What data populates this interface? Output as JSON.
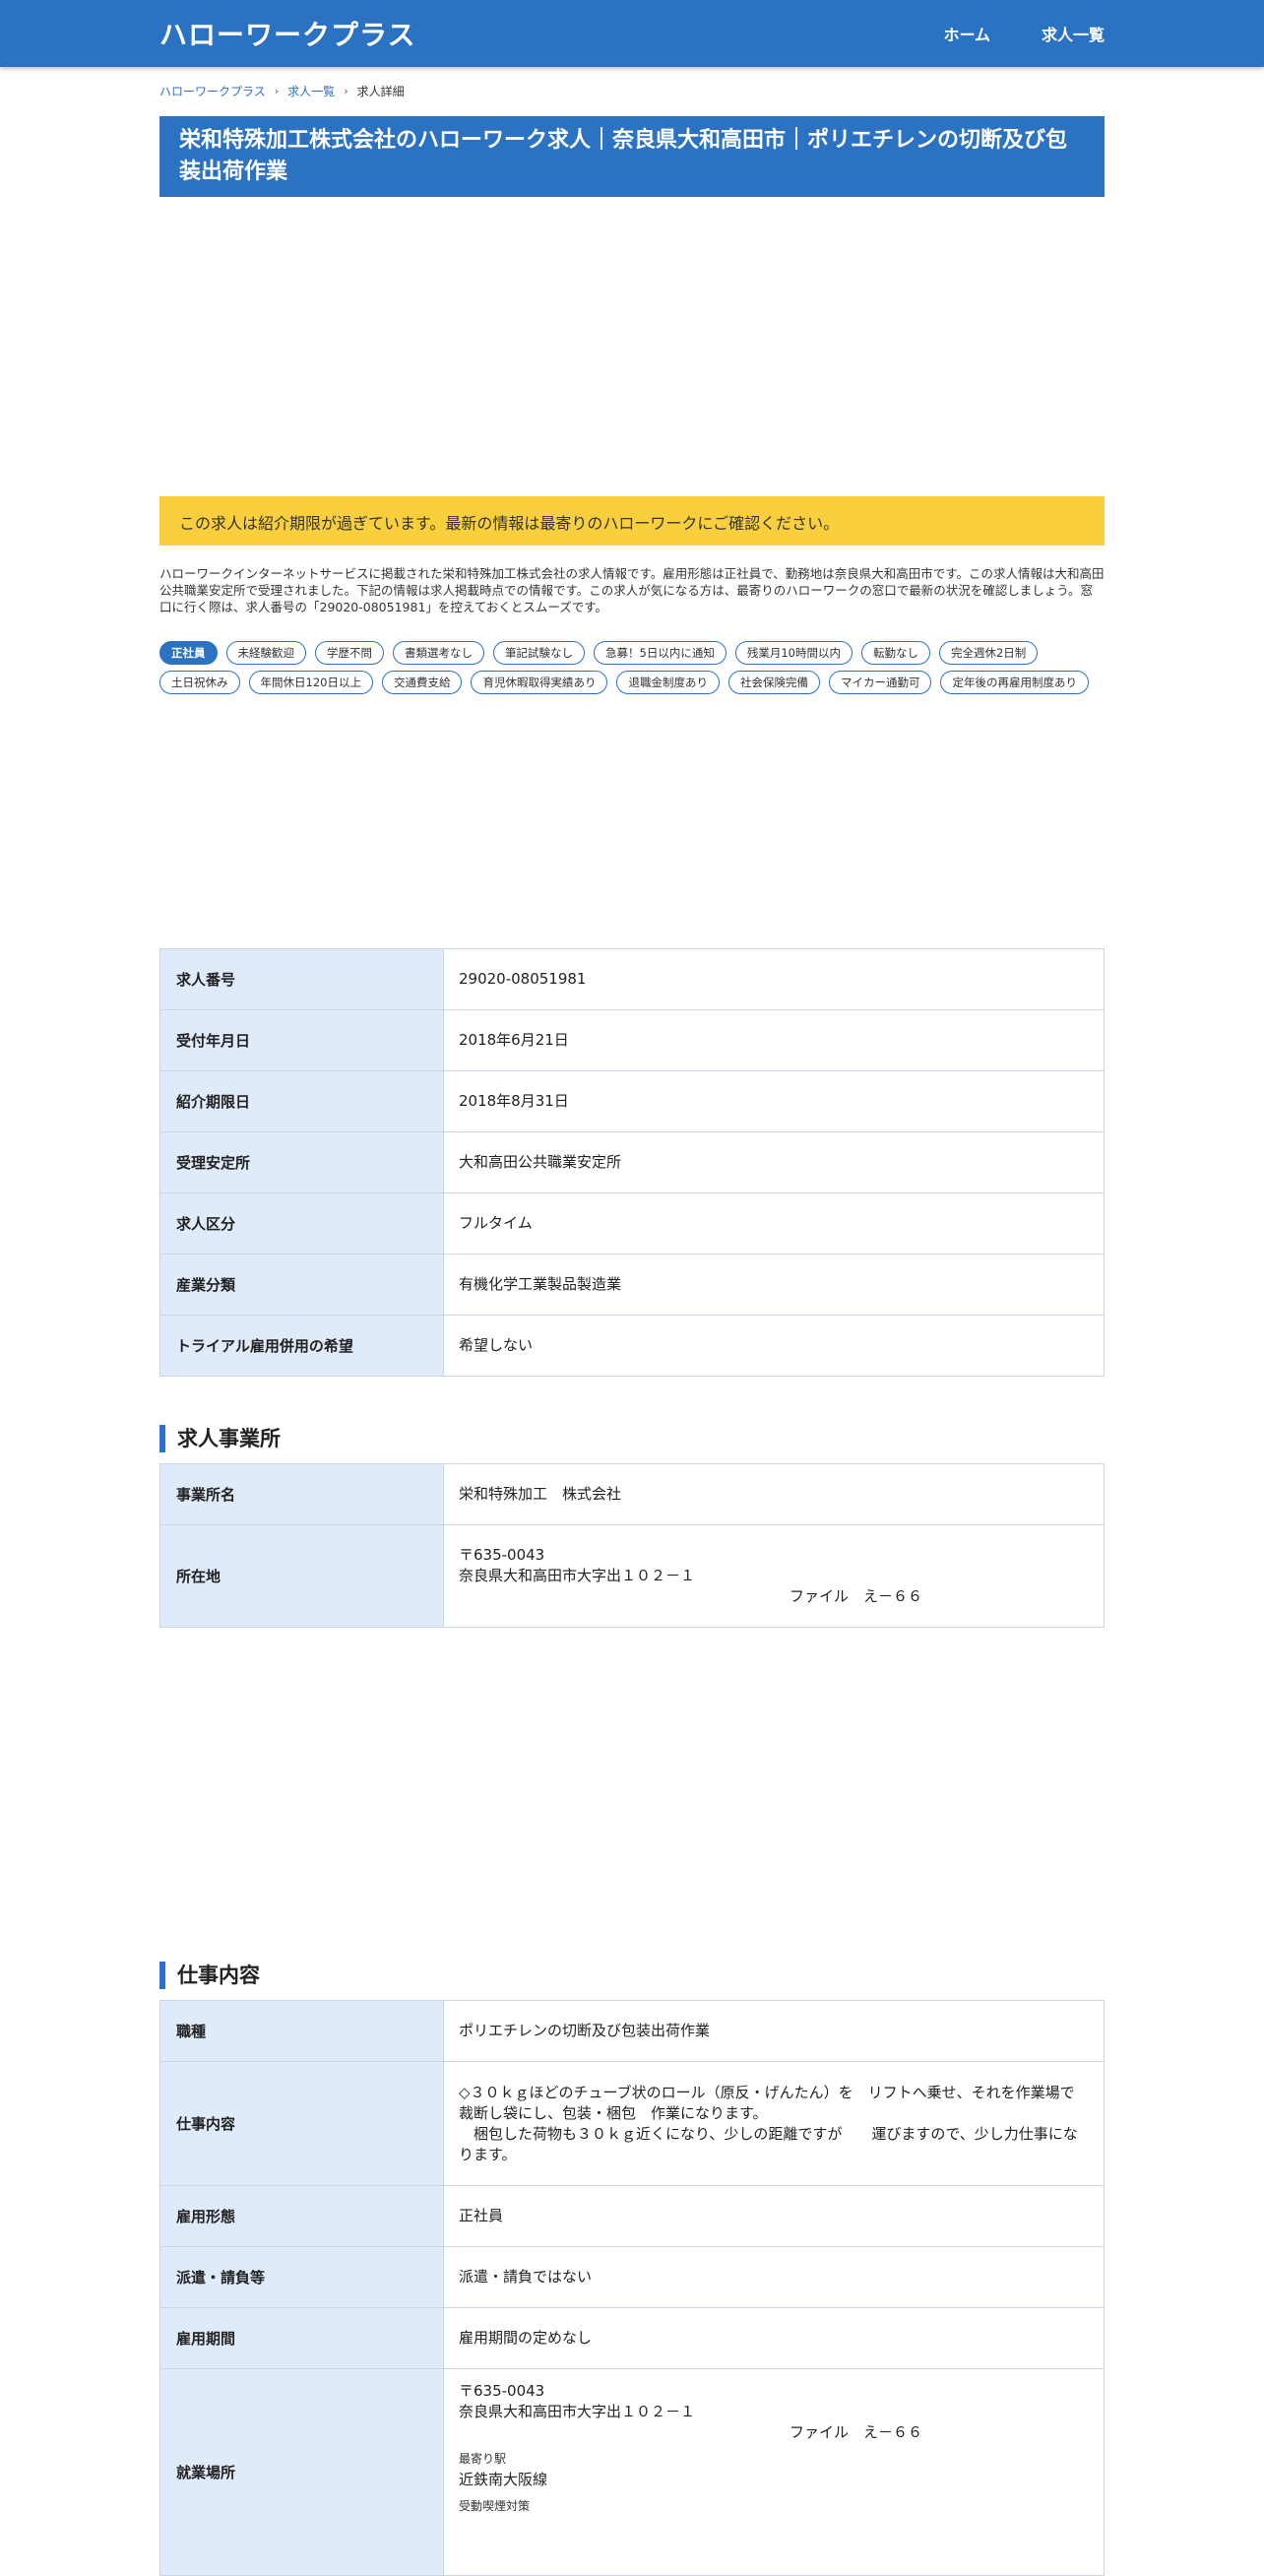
{
  "header": {
    "logo": "ハローワークプラス",
    "nav": [
      "ホーム",
      "求人一覧"
    ]
  },
  "breadcrumb": [
    "ハローワークプラス",
    "求人一覧",
    "求人詳細"
  ],
  "page_title": "栄和特殊加工株式会社のハローワーク求人｜奈良県大和高田市｜ポリエチレンの切断及び包装出荷作業",
  "notice": "この求人は紹介期限が過ぎています。最新の情報は最寄りのハローワークにご確認ください。",
  "intro": "ハローワークインターネットサービスに掲載された栄和特殊加工株式会社の求人情報です。雇用形態は正社員で、勤務地は奈良県大和高田市です。この求人情報は大和高田公共職業安定所で受理されました。下記の情報は求人掲載時点での情報です。この求人が気になる方は、最寄りのハローワークの窓口で最新の状況を確認しましょう。窓口に行く際は、求人番号の「29020-08051981」を控えておくとスムーズです。",
  "tags": [
    "正社員",
    "未経験歓迎",
    "学歴不問",
    "書類選考なし",
    "筆記試験なし",
    "急募！5日以内に通知",
    "残業月10時間以内",
    "転勤なし",
    "完全週休2日制",
    "土日祝休み",
    "年間休日120日以上",
    "交通費支給",
    "育児休暇取得実績あり",
    "退職金制度あり",
    "社会保険完備",
    "マイカー通勤可",
    "定年後の再雇用制度あり"
  ],
  "basic_info": [
    {
      "label": "求人番号",
      "value": "29020-08051981"
    },
    {
      "label": "受付年月日",
      "value": "2018年6月21日"
    },
    {
      "label": "紹介期限日",
      "value": "2018年8月31日"
    },
    {
      "label": "受理安定所",
      "value": "大和高田公共職業安定所"
    },
    {
      "label": "求人区分",
      "value": "フルタイム"
    },
    {
      "label": "産業分類",
      "value": "有機化学工業製品製造業"
    },
    {
      "label": "トライアル雇用併用の希望",
      "value": "希望しない"
    }
  ],
  "company_section": {
    "heading": "求人事業所",
    "name_label": "事業所名",
    "name_value": "栄和特殊加工　株式会社",
    "address_label": "所在地",
    "postal": "〒635-0043",
    "address1": "奈良県大和高田市大字出１０２－１",
    "address2": "ファイル　え－６６"
  },
  "job_section": {
    "heading": "仕事内容",
    "rows": [
      {
        "label": "職種",
        "value": "ポリエチレンの切断及び包装出荷作業"
      },
      {
        "label": "仕事内容",
        "value": "◇３０ｋｇほどのチューブ状のロール（原反・げんたん）を　リフトへ乗せ、それを作業場で裁断し袋にし、包装・梱包　作業になります。\n　梱包した荷物も３０ｋｇ近くになり、少しの距離ですが　　運びますので、少し力仕事になります。"
      },
      {
        "label": "雇用形態",
        "value": "正社員"
      },
      {
        "label": "派遣・請負等",
        "value": "派遣・請負ではない"
      },
      {
        "label": "雇用期間",
        "value": "雇用期間の定めなし"
      }
    ],
    "workplace": {
      "label": "就業場所",
      "postal": "〒635-0043",
      "address1": "奈良県大和高田市大字出１０２－１",
      "address2": "ファイル　え－６６",
      "station_label": "最寄り駅",
      "station": "近鉄南大阪線",
      "smoking_label": "受動喫煙対策"
    }
  }
}
